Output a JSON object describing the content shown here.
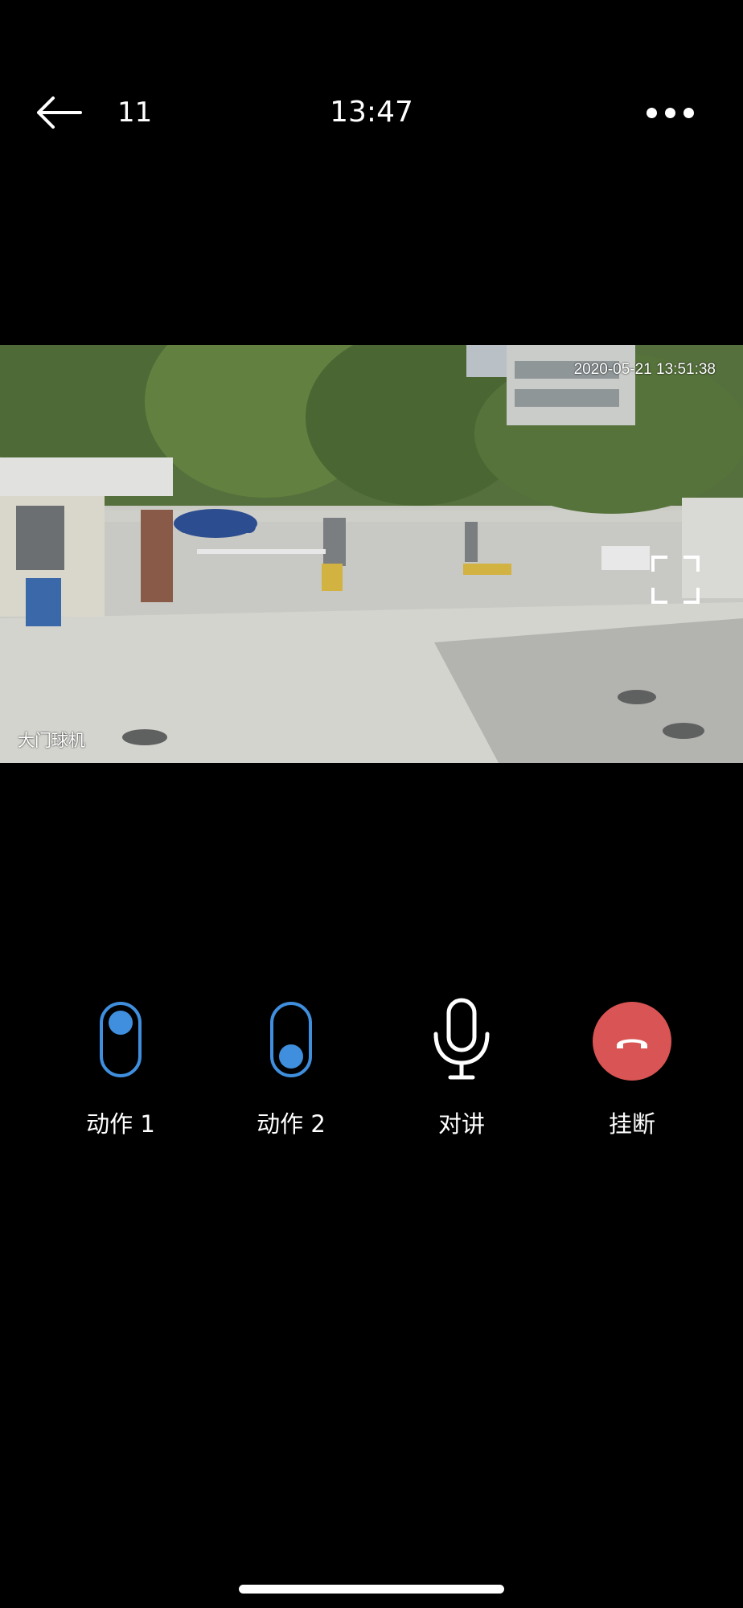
{
  "header": {
    "channel": "11",
    "time": "13:47"
  },
  "video": {
    "timestamp": "2020-05-21 13:51:38",
    "camera_label": "大门球机"
  },
  "controls": {
    "action1_label": "动作 1",
    "action2_label": "动作 2",
    "intercom_label": "对讲",
    "hangup_label": "挂断"
  },
  "colors": {
    "accent": "#3f8fde",
    "hangup": "#d95454",
    "background": "#000000"
  },
  "icons": [
    "arrow-left-icon",
    "more-dots-icon",
    "fullscreen-icon",
    "toggle-up-icon",
    "toggle-down-icon",
    "microphone-icon",
    "phone-hangup-icon"
  ]
}
